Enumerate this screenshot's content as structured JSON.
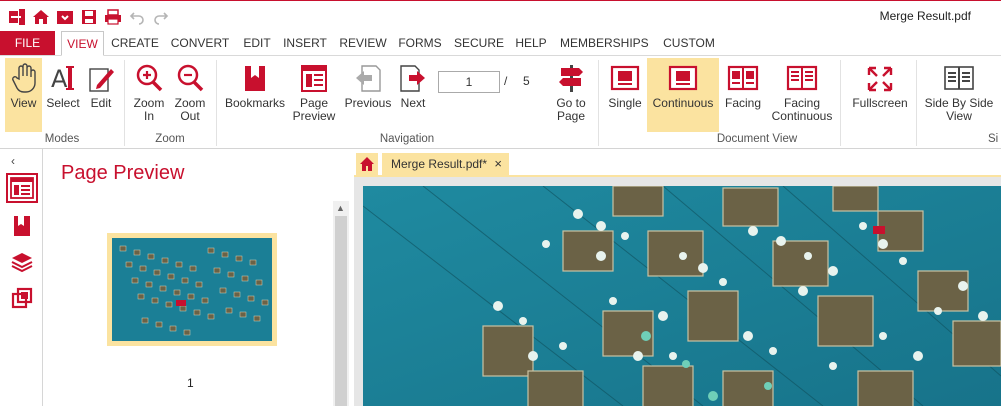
{
  "window": {
    "doc_title": "Merge Result.pdf"
  },
  "menu": {
    "file": "FILE",
    "tabs": [
      "VIEW",
      "CREATE",
      "CONVERT",
      "EDIT",
      "INSERT",
      "REVIEW",
      "FORMS",
      "SECURE",
      "HELP",
      "MEMBERSHIPS",
      "CUSTOM"
    ],
    "active": "VIEW"
  },
  "ribbon": {
    "view": "View",
    "select": "Select",
    "edit": "Edit",
    "zoom_in_1": "Zoom",
    "zoom_in_2": "In",
    "zoom_out_1": "Zoom",
    "zoom_out_2": "Out",
    "bookmarks": "Bookmarks",
    "page_preview_1": "Page",
    "page_preview_2": "Preview",
    "previous": "Previous",
    "next": "Next",
    "current_page": "1",
    "slash": "/",
    "total_pages": "5",
    "goto_1": "Go to",
    "goto_2": "Page",
    "single": "Single",
    "continuous": "Continuous",
    "facing": "Facing",
    "facing_cont_1": "Facing",
    "facing_cont_2": "Continuous",
    "fullscreen": "Fullscreen",
    "side_1": "Side By Side",
    "side_2": "View",
    "groups": {
      "modes": "Modes",
      "zoom": "Zoom",
      "navigation": "Navigation",
      "document_view": "Document View",
      "side_cut": "Si"
    }
  },
  "preview": {
    "title": "Page Preview",
    "page_number": "1"
  },
  "doc_tab": {
    "name": "Merge Result.pdf*",
    "close": "×"
  },
  "colors": {
    "accent": "#c8102e",
    "highlight": "#fbe3a0",
    "water": "#1b7f96"
  }
}
